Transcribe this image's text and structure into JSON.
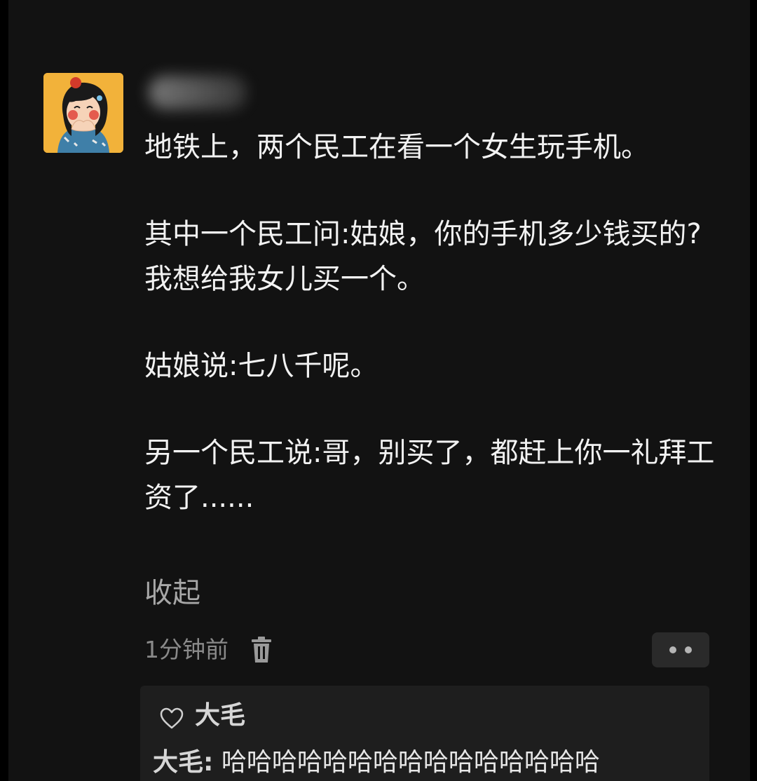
{
  "post": {
    "username": "",
    "paragraphs": [
      "地铁上，两个民工在看一个女生玩手机。",
      "其中一个民工问:姑娘，你的手机多少钱买的?我想给我女儿买一个。",
      "姑娘说:七八千呢。",
      "另一个民工说:哥，别买了，都赶上你一礼拜工资了......"
    ],
    "collapse_label": "收起",
    "timestamp": "1分钟前",
    "delete_icon": "trash-icon",
    "more_icon": "more-dots-icon"
  },
  "comments": {
    "likes_icon": "heart-outline-icon",
    "likes_user": "大毛",
    "items": [
      {
        "author": "大毛:",
        "text": " 哈哈哈哈哈哈哈哈哈哈哈哈哈哈哈"
      }
    ]
  },
  "colors": {
    "background": "#121212",
    "text": "#f2f2f2",
    "muted": "#8a8a8a",
    "comment_panel": "#1e1e1e",
    "avatar_bg": "#f2b23a"
  }
}
